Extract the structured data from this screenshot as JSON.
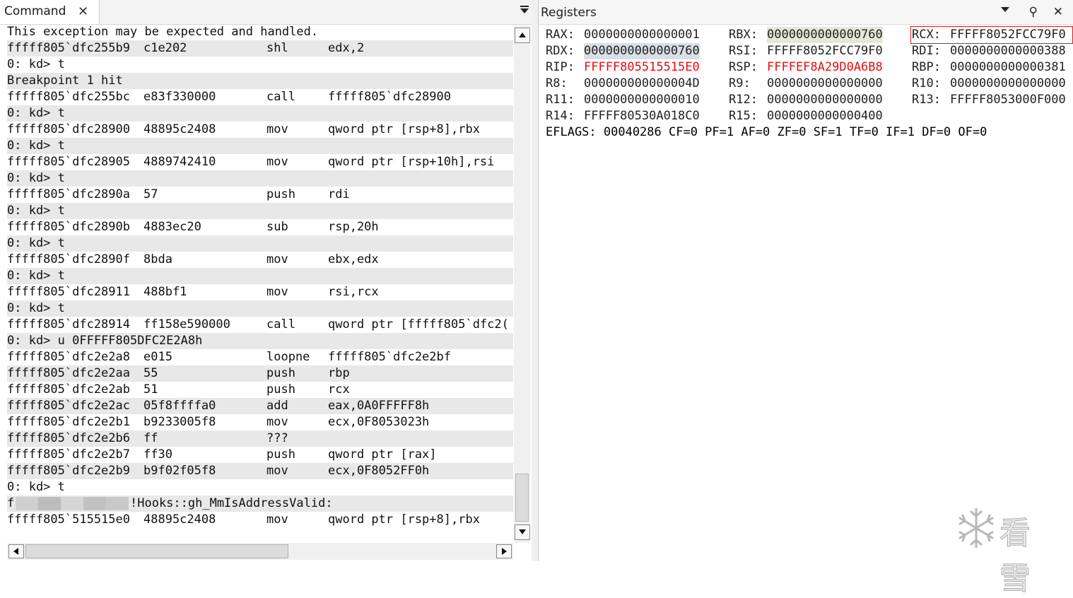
{
  "command_window": {
    "tab_title": "Command",
    "lines": [
      {
        "addr": "This exception may be expected and handled.",
        "bytes": "",
        "mnemonic": "",
        "operands": ""
      },
      {
        "addr": "fffff805`dfc255b9",
        "bytes": "c1e202",
        "mnemonic": "shl",
        "operands": "edx,2"
      },
      {
        "addr": "0: kd> t",
        "bytes": "",
        "mnemonic": "",
        "operands": ""
      },
      {
        "addr": "Breakpoint 1 hit",
        "bytes": "",
        "mnemonic": "",
        "operands": ""
      },
      {
        "addr": "fffff805`dfc255bc",
        "bytes": "e83f330000",
        "mnemonic": "call",
        "operands": "fffff805`dfc28900"
      },
      {
        "addr": "0: kd> t",
        "bytes": "",
        "mnemonic": "",
        "operands": ""
      },
      {
        "addr": "fffff805`dfc28900",
        "bytes": "48895c2408",
        "mnemonic": "mov",
        "operands": "qword ptr [rsp+8],rbx"
      },
      {
        "addr": "0: kd> t",
        "bytes": "",
        "mnemonic": "",
        "operands": ""
      },
      {
        "addr": "fffff805`dfc28905",
        "bytes": "4889742410",
        "mnemonic": "mov",
        "operands": "qword ptr [rsp+10h],rsi"
      },
      {
        "addr": "0: kd> t",
        "bytes": "",
        "mnemonic": "",
        "operands": ""
      },
      {
        "addr": "fffff805`dfc2890a",
        "bytes": "57",
        "mnemonic": "push",
        "operands": "rdi"
      },
      {
        "addr": "0: kd> t",
        "bytes": "",
        "mnemonic": "",
        "operands": ""
      },
      {
        "addr": "fffff805`dfc2890b",
        "bytes": "4883ec20",
        "mnemonic": "sub",
        "operands": "rsp,20h"
      },
      {
        "addr": "0: kd> t",
        "bytes": "",
        "mnemonic": "",
        "operands": ""
      },
      {
        "addr": "fffff805`dfc2890f",
        "bytes": "8bda",
        "mnemonic": "mov",
        "operands": "ebx,edx"
      },
      {
        "addr": "0: kd> t",
        "bytes": "",
        "mnemonic": "",
        "operands": ""
      },
      {
        "addr": "fffff805`dfc28911",
        "bytes": "488bf1",
        "mnemonic": "mov",
        "operands": "rsi,rcx"
      },
      {
        "addr": "0: kd> t",
        "bytes": "",
        "mnemonic": "",
        "operands": ""
      },
      {
        "addr": "fffff805`dfc28914",
        "bytes": "ff158e590000",
        "mnemonic": "call",
        "operands": "qword ptr [fffff805`dfc2("
      },
      {
        "addr": "0: kd> u 0FFFFF805DFC2E2A8h",
        "bytes": "",
        "mnemonic": "",
        "operands": ""
      },
      {
        "addr": "fffff805`dfc2e2a8",
        "bytes": "e015",
        "mnemonic": "loopne",
        "operands": "fffff805`dfc2e2bf"
      },
      {
        "addr": "fffff805`dfc2e2aa",
        "bytes": "55",
        "mnemonic": "push",
        "operands": "rbp"
      },
      {
        "addr": "fffff805`dfc2e2ab",
        "bytes": "51",
        "mnemonic": "push",
        "operands": "rcx"
      },
      {
        "addr": "fffff805`dfc2e2ac",
        "bytes": "05f8ffffa0",
        "mnemonic": "add",
        "operands": "eax,0A0FFFFF8h"
      },
      {
        "addr": "fffff805`dfc2e2b1",
        "bytes": "b9233005f8",
        "mnemonic": "mov",
        "operands": "ecx,0F8053023h"
      },
      {
        "addr": "fffff805`dfc2e2b6",
        "bytes": "ff",
        "mnemonic": "???",
        "operands": ""
      },
      {
        "addr": "fffff805`dfc2e2b7",
        "bytes": "ff30",
        "mnemonic": "push",
        "operands": "qword ptr [rax]"
      },
      {
        "addr": "fffff805`dfc2e2b9",
        "bytes": "b9f02f05f8",
        "mnemonic": "mov",
        "operands": "ecx,0F8052FF0h"
      },
      {
        "addr": "0: kd> t",
        "bytes": "",
        "mnemonic": "",
        "operands": ""
      },
      {
        "addr": "!Hooks::gh_MmIsAddressValid:",
        "bytes": "",
        "mnemonic": "",
        "operands": ""
      },
      {
        "addr": "fffff805`515515e0",
        "bytes": "48895c2408",
        "mnemonic": "mov",
        "operands": "qword ptr [rsp+8],rbx"
      }
    ]
  },
  "registers_window": {
    "title": "Registers",
    "rows": [
      [
        {
          "name": "RAX:",
          "value": "0000000000000001",
          "style": ""
        },
        {
          "name": "RBX:",
          "value": "0000000000000760",
          "style": "hl"
        },
        {
          "name": "RCX:",
          "value": "FFFFF8052FCC79F0",
          "style": "boxed"
        }
      ],
      [
        {
          "name": "RDX:",
          "value": "0000000000000760",
          "style": "hl2"
        },
        {
          "name": "RSI:",
          "value": "FFFFF8052FCC79F0",
          "style": ""
        },
        {
          "name": "RDI:",
          "value": "0000000000000388",
          "style": ""
        }
      ],
      [
        {
          "name": "RIP:",
          "value": "FFFFF805515515E0",
          "style": "red"
        },
        {
          "name": "RSP:",
          "value": "FFFFEF8A29D0A6B8",
          "style": "red"
        },
        {
          "name": "RBP:",
          "value": "0000000000000381",
          "style": ""
        }
      ],
      [
        {
          "name": "R8:",
          "value": "000000000000004D",
          "style": ""
        },
        {
          "name": "R9:",
          "value": "0000000000000000",
          "style": ""
        },
        {
          "name": "R10:",
          "value": "0000000000000000",
          "style": ""
        }
      ],
      [
        {
          "name": "R11:",
          "value": "0000000000000010",
          "style": ""
        },
        {
          "name": "R12:",
          "value": "0000000000000000",
          "style": ""
        },
        {
          "name": "R13:",
          "value": "FFFFF8053000F000",
          "style": ""
        }
      ],
      [
        {
          "name": "R14:",
          "value": "FFFFF80530A018C0",
          "style": ""
        },
        {
          "name": "R15:",
          "value": "0000000000000400",
          "style": ""
        }
      ]
    ],
    "eflags": "EFLAGS: 00040286 CF=0 PF=1 AF=0 ZF=0 SF=1 TF=0 IF=1 DF=0 OF=0"
  },
  "watermark": {
    "text": "看雪",
    "icon": "snowflake-icon"
  },
  "colors": {
    "red": "#e01010",
    "highlight_rbx": "#e4e8d6",
    "highlight_rdx": "#d9dfe5",
    "box": "#d21f1f"
  }
}
